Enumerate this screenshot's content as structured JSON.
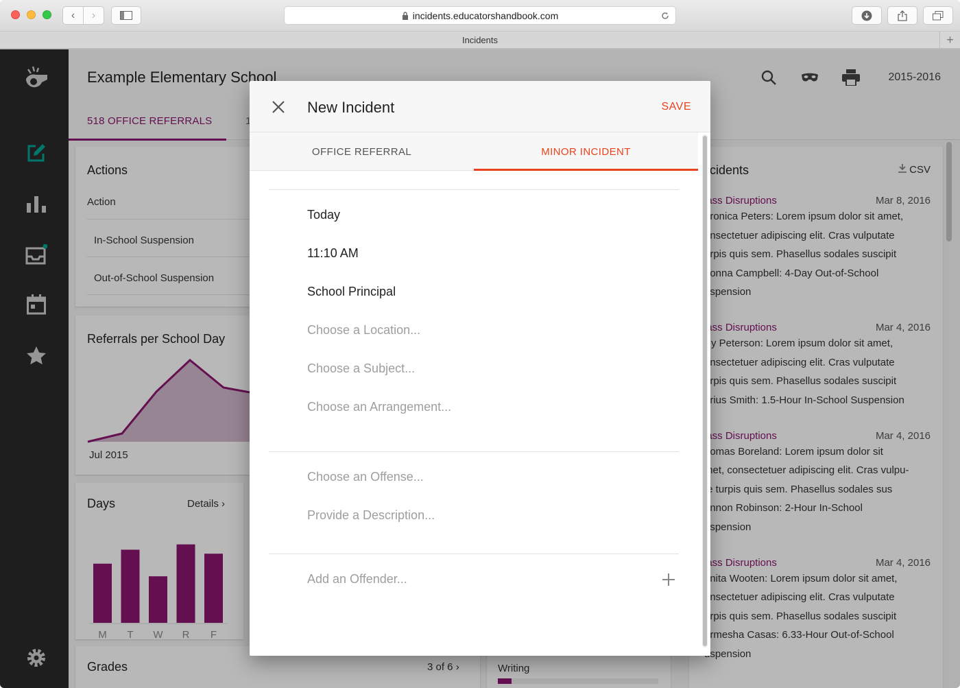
{
  "browser": {
    "url": "incidents.educatorshandbook.com",
    "tab_title": "Incidents"
  },
  "header": {
    "school_name": "Example Elementary School",
    "year": "2015-2016",
    "tabs": [
      {
        "label": "518 OFFICE REFERRALS"
      },
      {
        "label": "1"
      }
    ]
  },
  "actions_card": {
    "title": "Actions",
    "column": "Action",
    "rows": [
      "In-School Suspension",
      "Out-of-School Suspension"
    ]
  },
  "referrals_card": {
    "title": "Referrals per School Day",
    "x_label": "Jul 2015"
  },
  "days_card": {
    "title": "Days",
    "details": "Details",
    "chart_data": {
      "type": "bar",
      "categories": [
        "M",
        "T",
        "W",
        "R",
        "F"
      ],
      "values": [
        89,
        110,
        70,
        118,
        104
      ],
      "ylim": [
        0,
        130
      ]
    }
  },
  "grades_card": {
    "title": "Grades",
    "pager": "3 of 6"
  },
  "writing_card": {
    "label": "Writing"
  },
  "incidents_feed": {
    "title": "ncidents",
    "csv": "CSV",
    "items": [
      {
        "title": "lass Disruptions",
        "date": "Mar 8, 2016",
        "lines": [
          "eronica Peters: Lorem ipsum dolor sit amet,",
          "onsectetuer adipiscing elit. Cras vulputate",
          "urpis quis sem. Phasellus sodales suscipit",
          "rionna Campbell: 4-Day Out-of-School",
          "uspension"
        ]
      },
      {
        "title": "lass Disruptions",
        "date": "Mar 4, 2016",
        "lines": [
          "illy Peterson: Lorem ipsum dolor sit amet,",
          "onsectetuer adipiscing elit. Cras vulputate",
          "urpis quis sem. Phasellus sodales suscipit",
          "arius Smith: 1.5-Hour In-School Suspension"
        ]
      },
      {
        "title": "lass Disruptions",
        "date": "Mar 4, 2016",
        "lines": [
          "homas Boreland: Lorem ipsum dolor sit",
          "met, consectetuer adipiscing elit. Cras vulpu-",
          "te turpis quis sem. Phasellus sodales sus",
          "ennon Robinson: 2-Hour In-School",
          "uspension"
        ]
      },
      {
        "title": "lass Disruptions",
        "date": "Mar 4, 2016",
        "lines": [
          "anita Wooten: Lorem ipsum dolor sit amet,",
          "onsectetuer adipiscing elit. Cras vulputate",
          "urpis quis sem. Phasellus sodales suscipit",
          "armesha Casas: 6.33-Hour Out-of-School",
          "uspension"
        ]
      }
    ]
  },
  "modal": {
    "title": "New Incident",
    "save": "SAVE",
    "tabs": [
      "OFFICE REFERRAL",
      "MINOR INCIDENT"
    ],
    "fields": {
      "date": "Today",
      "time": "11:10 AM",
      "staff": "School Principal",
      "location": "Choose a Location...",
      "subject": "Choose a Subject...",
      "arrangement": "Choose an Arrangement...",
      "offense": "Choose an Offense...",
      "description": "Provide a Description...",
      "offender": "Add an Offender..."
    }
  },
  "colors": {
    "accent": "#e8431c",
    "brand": "#8a1670",
    "nav_active": "#00a693"
  }
}
